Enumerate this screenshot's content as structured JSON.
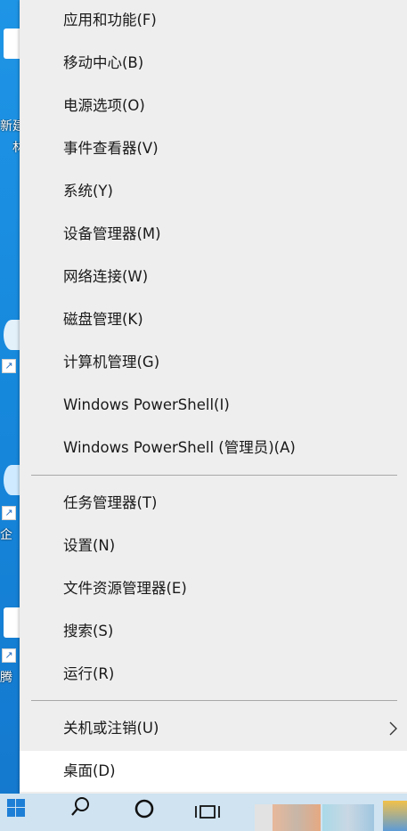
{
  "desktop": {
    "icons": [
      {
        "label": "新建",
        "sub": "林"
      },
      {
        "label": "",
        "sub": ""
      },
      {
        "label": "企",
        "sub": ""
      },
      {
        "label": "腾",
        "sub": ""
      }
    ]
  },
  "menu": {
    "group1": [
      {
        "label": "应用和功能(F)"
      },
      {
        "label": "移动中心(B)"
      },
      {
        "label": "电源选项(O)"
      },
      {
        "label": "事件查看器(V)"
      },
      {
        "label": "系统(Y)"
      },
      {
        "label": "设备管理器(M)"
      },
      {
        "label": "网络连接(W)"
      },
      {
        "label": "磁盘管理(K)"
      },
      {
        "label": "计算机管理(G)"
      },
      {
        "label": "Windows PowerShell(I)"
      },
      {
        "label": "Windows PowerShell (管理员)(A)"
      }
    ],
    "group2": [
      {
        "label": "任务管理器(T)"
      },
      {
        "label": "设置(N)"
      },
      {
        "label": "文件资源管理器(E)"
      },
      {
        "label": "搜索(S)"
      },
      {
        "label": "运行(R)"
      }
    ],
    "group3": [
      {
        "label": "关机或注销(U)",
        "has_submenu": true
      },
      {
        "label": "桌面(D)",
        "highlighted": true
      }
    ]
  },
  "taskbar": {
    "icons": [
      "windows-start-icon",
      "search-icon",
      "cortana-icon",
      "task-view-icon"
    ]
  }
}
